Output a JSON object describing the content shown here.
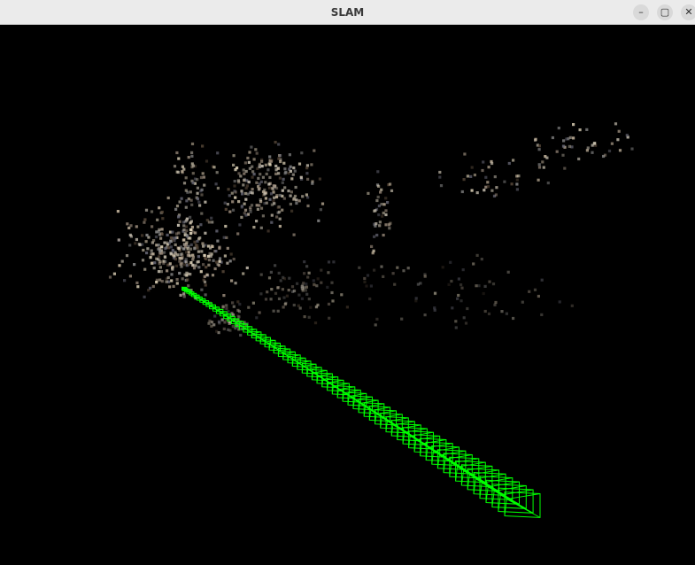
{
  "window": {
    "title": "SLAM",
    "minimize_glyph": "–",
    "maximize_glyph": "▢",
    "close_glyph": "✕"
  },
  "viewer": {
    "background_color": "#000000",
    "trajectory_color": "#00ff00",
    "map_point_colors": [
      "#e8dcc0",
      "#c8b8a0",
      "#a09080",
      "#8a8a8a",
      "#6a6a78",
      "#5a4a3a",
      "#d0c8b8",
      "#b0a898"
    ]
  }
}
